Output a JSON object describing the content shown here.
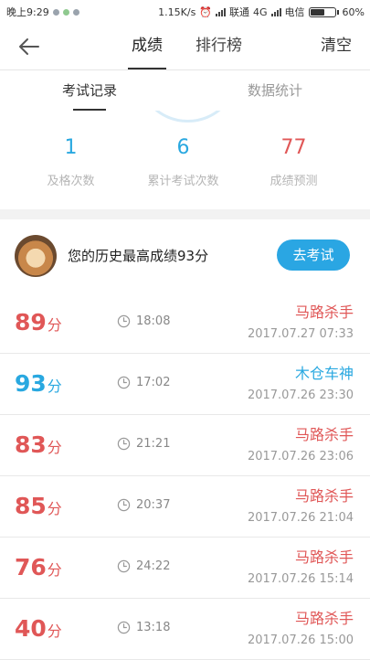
{
  "status_bar": {
    "left_text": "晚上9:29",
    "speed": "1.15K/s",
    "network": "4G",
    "carrier": "联通",
    "carrier2": "电信",
    "battery": "60%",
    "battery_level": 0.6
  },
  "nav": {
    "tabs": [
      "成绩",
      "排行榜"
    ],
    "active_tab": "成绩",
    "clear_label": "清空"
  },
  "subtabs": {
    "items": [
      "考试记录",
      "数据统计"
    ],
    "active": "考试记录"
  },
  "stats": [
    {
      "value": "1",
      "label": "及格次数"
    },
    {
      "value": "6",
      "label": "累计考试次数"
    },
    {
      "value": "77",
      "label": "成绩预测"
    }
  ],
  "best": {
    "text": "您的历史最高成绩93分",
    "button_label": "去考试"
  },
  "records": [
    {
      "score": "89",
      "unit": "分",
      "duration": "18:08",
      "title": "马路杀手",
      "date": "2017.07.27  07:33",
      "color": "red"
    },
    {
      "score": "93",
      "unit": "分",
      "duration": "17:02",
      "title": "木仓车神",
      "date": "2017.07.26  23:30",
      "color": "blue"
    },
    {
      "score": "83",
      "unit": "分",
      "duration": "21:21",
      "title": "马路杀手",
      "date": "2017.07.26  23:06",
      "color": "red"
    },
    {
      "score": "85",
      "unit": "分",
      "duration": "20:37",
      "title": "马路杀手",
      "date": "2017.07.26  21:04",
      "color": "red"
    },
    {
      "score": "76",
      "unit": "分",
      "duration": "24:22",
      "title": "马路杀手",
      "date": "2017.07.26  15:14",
      "color": "red"
    },
    {
      "score": "40",
      "unit": "分",
      "duration": "13:18",
      "title": "马路杀手",
      "date": "2017.07.26  15:00",
      "color": "red"
    }
  ],
  "colors": {
    "accent_blue": "#29a8e0",
    "accent_red": "#e05757",
    "button_blue": "#2aa6e3"
  }
}
